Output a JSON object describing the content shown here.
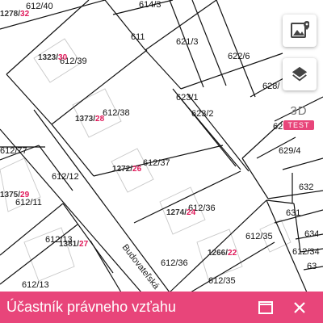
{
  "parcels": {
    "p612_40": "612/40",
    "p614_3": "614/3",
    "p611": "611",
    "p621_3": "621/3",
    "p612_39": "612/39",
    "p622_6": "622/6",
    "p628": "628/",
    "p623_1": "623/1",
    "p623_2": "623/2",
    "p612_38": "612/38",
    "p62x": "62",
    "p629_4": "629/4",
    "p612_77": "612/77",
    "p612_37": "612/37",
    "p612_12": "612/12",
    "p632": "632",
    "p612_11": "612/11",
    "p612_36a": "612/36",
    "p631": "631",
    "p612_13a": "612/13",
    "p612_35a": "612/35",
    "p634": "634",
    "p612_34": "612/34",
    "p612_36b": "612/36",
    "p63": "63",
    "p612_13b": "612/13",
    "p612_35b": "612/35"
  },
  "house_numbers": {
    "h1278": {
      "main": "1278/",
      "sub": "32"
    },
    "h1323": {
      "main": "1323/",
      "sub": "30"
    },
    "h1373": {
      "main": "1373/",
      "sub": "28"
    },
    "h1272": {
      "main": "1272/",
      "sub": "26"
    },
    "h1375": {
      "main": "1375/",
      "sub": "29"
    },
    "h1274": {
      "main": "1274/",
      "sub": "24"
    },
    "h1381": {
      "main": "1381/",
      "sub": "27"
    },
    "h1266": {
      "main": "1266/",
      "sub": "22"
    }
  },
  "street_name": "Budovateľská",
  "controls": {
    "photo_icon": "map-photo-icon",
    "layers_icon": "layers-icon",
    "three_d_label": "3D",
    "test_badge": "TEST"
  },
  "panel": {
    "title": "Účastník právneho vzťahu",
    "maximize_icon": "maximize-icon",
    "close_icon": "close-icon"
  },
  "colors": {
    "accent": "#e8457a",
    "house_subnumber": "#e0195a"
  }
}
